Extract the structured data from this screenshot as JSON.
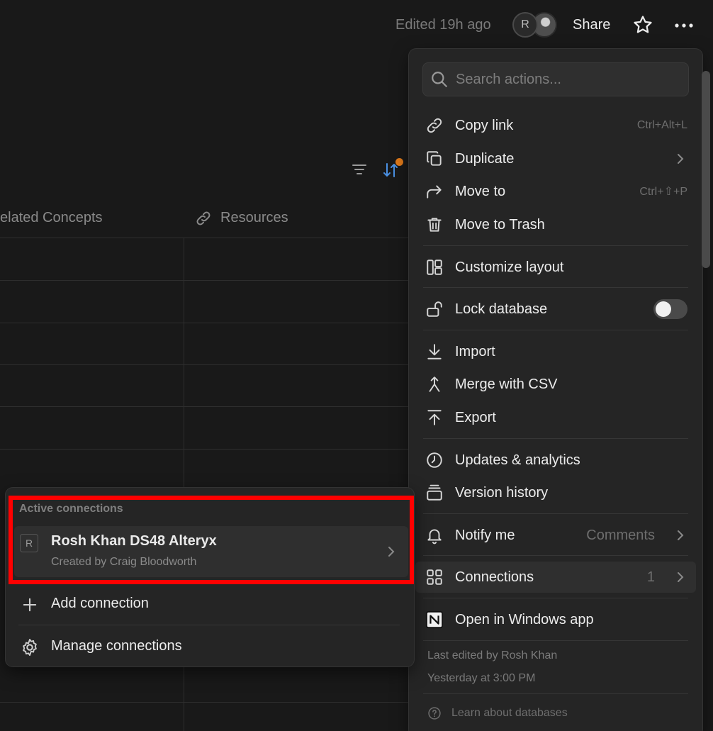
{
  "header": {
    "edited": "Edited 19h ago",
    "avatar_initial": "R",
    "share_label": "Share"
  },
  "table": {
    "columns": [
      "elated Concepts",
      "Resources"
    ]
  },
  "menu": {
    "search_placeholder": "Search actions...",
    "copy_link": {
      "label": "Copy link",
      "shortcut": "Ctrl+Alt+L"
    },
    "duplicate": {
      "label": "Duplicate"
    },
    "move_to": {
      "label": "Move to",
      "shortcut": "Ctrl+⇧+P"
    },
    "move_to_trash": {
      "label": "Move to Trash"
    },
    "customize_layout": {
      "label": "Customize layout"
    },
    "lock_database": {
      "label": "Lock database",
      "toggle_on": false
    },
    "import": {
      "label": "Import"
    },
    "merge_csv": {
      "label": "Merge with CSV"
    },
    "export": {
      "label": "Export"
    },
    "updates": {
      "label": "Updates & analytics"
    },
    "version_history": {
      "label": "Version history"
    },
    "notify": {
      "label": "Notify me",
      "value": "Comments"
    },
    "connections": {
      "label": "Connections",
      "count": "1"
    },
    "open_windows": {
      "label": "Open in Windows app"
    },
    "last_edited_by": "Last edited by Rosh Khan",
    "last_edited_time": "Yesterday at 3:00 PM",
    "learn": "Learn about databases"
  },
  "connections_submenu": {
    "header": "Active connections",
    "item": {
      "badge": "R",
      "title": "Rosh Khan DS48 Alteryx",
      "subtitle": "Created by Craig Bloodworth"
    },
    "add": "Add connection",
    "manage": "Manage connections"
  },
  "colors": {
    "background": "#191919",
    "menu": "#252525",
    "accent_sort": "#4a90e2",
    "dot": "#e07a1a",
    "highlight": "#ff0000"
  }
}
